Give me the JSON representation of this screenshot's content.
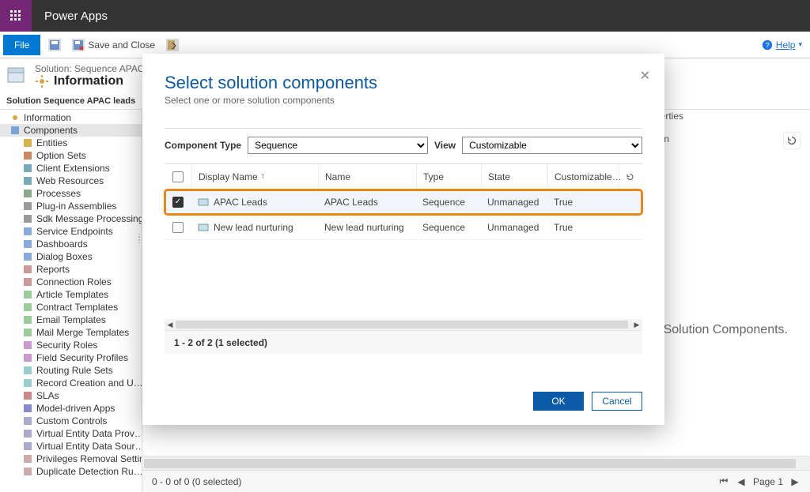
{
  "header": {
    "app": "Power Apps"
  },
  "ribbon": {
    "file": "File",
    "save_close": "Save and Close",
    "help": "Help",
    "managed_props": "Managed Properties"
  },
  "breadcrumb": {
    "solution_prefix": "Solution: Sequence APAC le",
    "info": "Information",
    "section": "Solution Sequence APAC leads"
  },
  "tree": {
    "root": "Information",
    "components": "Components",
    "items": [
      "Entities",
      "Option Sets",
      "Client Extensions",
      "Web Resources",
      "Processes",
      "Plug-in Assemblies",
      "Sdk Message Processing…",
      "Service Endpoints",
      "Dashboards",
      "Dialog Boxes",
      "Reports",
      "Connection Roles",
      "Article Templates",
      "Contract Templates",
      "Email Templates",
      "Mail Merge Templates",
      "Security Roles",
      "Field Security Profiles",
      "Routing Rule Sets",
      "Record Creation and U…",
      "SLAs",
      "Model-driven Apps",
      "Custom Controls",
      "Virtual Entity Data Prov…",
      "Virtual Entity Data Sour…",
      "Privileges Removal Setting",
      "Duplicate Detection Ru…"
    ]
  },
  "background": {
    "hint_tail": "e Solution Components.",
    "ion_tail": "ion",
    "status": "0 - 0 of 0 (0 selected)",
    "page": "Page 1"
  },
  "dialog": {
    "title": "Select solution components",
    "subtitle": "Select one or more solution components",
    "componentType_label": "Component Type",
    "componentType_value": "Sequence",
    "view_label": "View",
    "view_value": "Customizable",
    "cols": {
      "displayName": "Display Name",
      "name": "Name",
      "type": "Type",
      "state": "State",
      "customizable": "Customizable…"
    },
    "rows": [
      {
        "checked": true,
        "displayName": "APAC Leads",
        "name": "APAC Leads",
        "type": "Sequence",
        "state": "Unmanaged",
        "customizable": "True",
        "highlight": true
      },
      {
        "checked": false,
        "displayName": "New lead nurturing",
        "name": "New lead nurturing",
        "type": "Sequence",
        "state": "Unmanaged",
        "customizable": "True",
        "highlight": false
      }
    ],
    "status": "1 - 2 of 2 (1 selected)",
    "ok": "OK",
    "cancel": "Cancel"
  }
}
